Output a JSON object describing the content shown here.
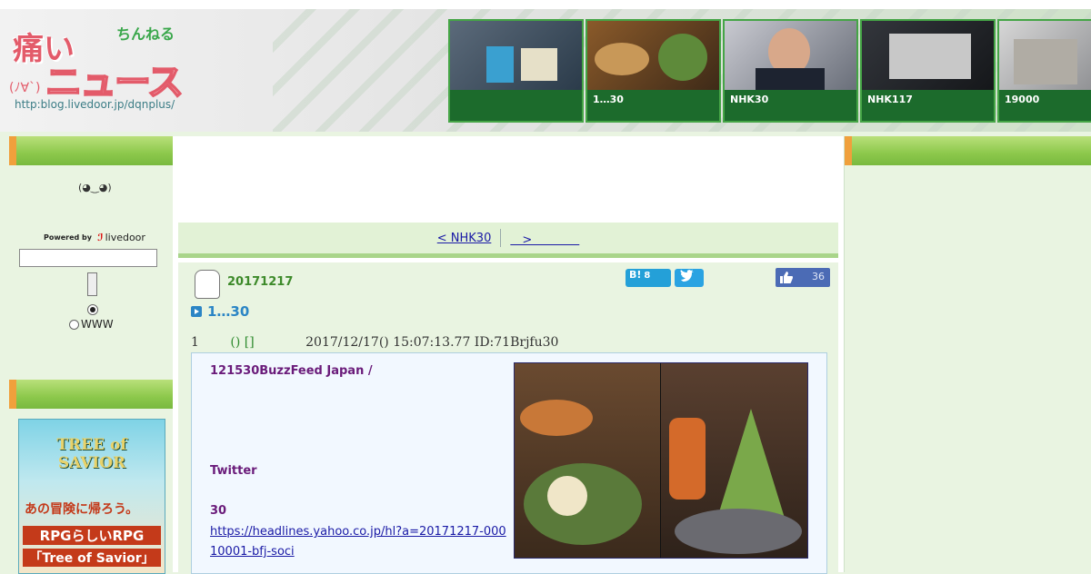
{
  "header": {
    "logo": {
      "big": "痛い",
      "chan": "ちんねる",
      "nyu": "ニュース",
      "face": "(ﾉ∀`)",
      "url": "http:blog.livedoor.jp/dqnplus/"
    },
    "thumbs": [
      {
        "caption": "",
        "colors": [
          "#5b6a7a",
          "#2b3b4a"
        ]
      },
      {
        "caption": "1…30",
        "colors": [
          "#8a5a2a",
          "#3e2a18"
        ]
      },
      {
        "caption": "NHK30",
        "colors": [
          "#c8c9d0",
          "#6a6f7a"
        ]
      },
      {
        "caption": "NHK117",
        "colors": [
          "#33363c",
          "#15171a"
        ]
      },
      {
        "caption": "19000",
        "colors": [
          "#d6d6d6",
          "#8e8f92"
        ]
      }
    ]
  },
  "left": {
    "emoji": "(◕‿◕)",
    "powered_by": "Powered by",
    "livedoor": "livedoor",
    "search_placeholder": "",
    "radio_www": "WWW",
    "ad_title": "TREE of SAVIOR",
    "ad_line1": "あの冒険に帰ろう。",
    "ad_line2": "RPGらしいRPG",
    "ad_line3": "「Tree of Savior」"
  },
  "main": {
    "nav": {
      "prev": "< NHK30",
      "next": "　>　　　　"
    },
    "entry": {
      "date": "20171217",
      "hatena_count": "8",
      "like_count": "36",
      "title": "1…30",
      "post_header": {
        "num": "1",
        "name": "() []",
        "datetime": "2017/12/17() 15:07:13.77 ID:71Brjfu30"
      },
      "body_line1": "121530BuzzFeed Japan /",
      "body_twitter": "Twitter",
      "body_30": "30",
      "link": "https://headlines.yahoo.co.jp/hl?a=20171217-00010001-bfj-soci"
    }
  },
  "colors": {
    "green_bar": "#8cc84b",
    "orange": "#f0a03c",
    "link": "#1a1aa6",
    "bodytext": "#6a1b7a"
  }
}
